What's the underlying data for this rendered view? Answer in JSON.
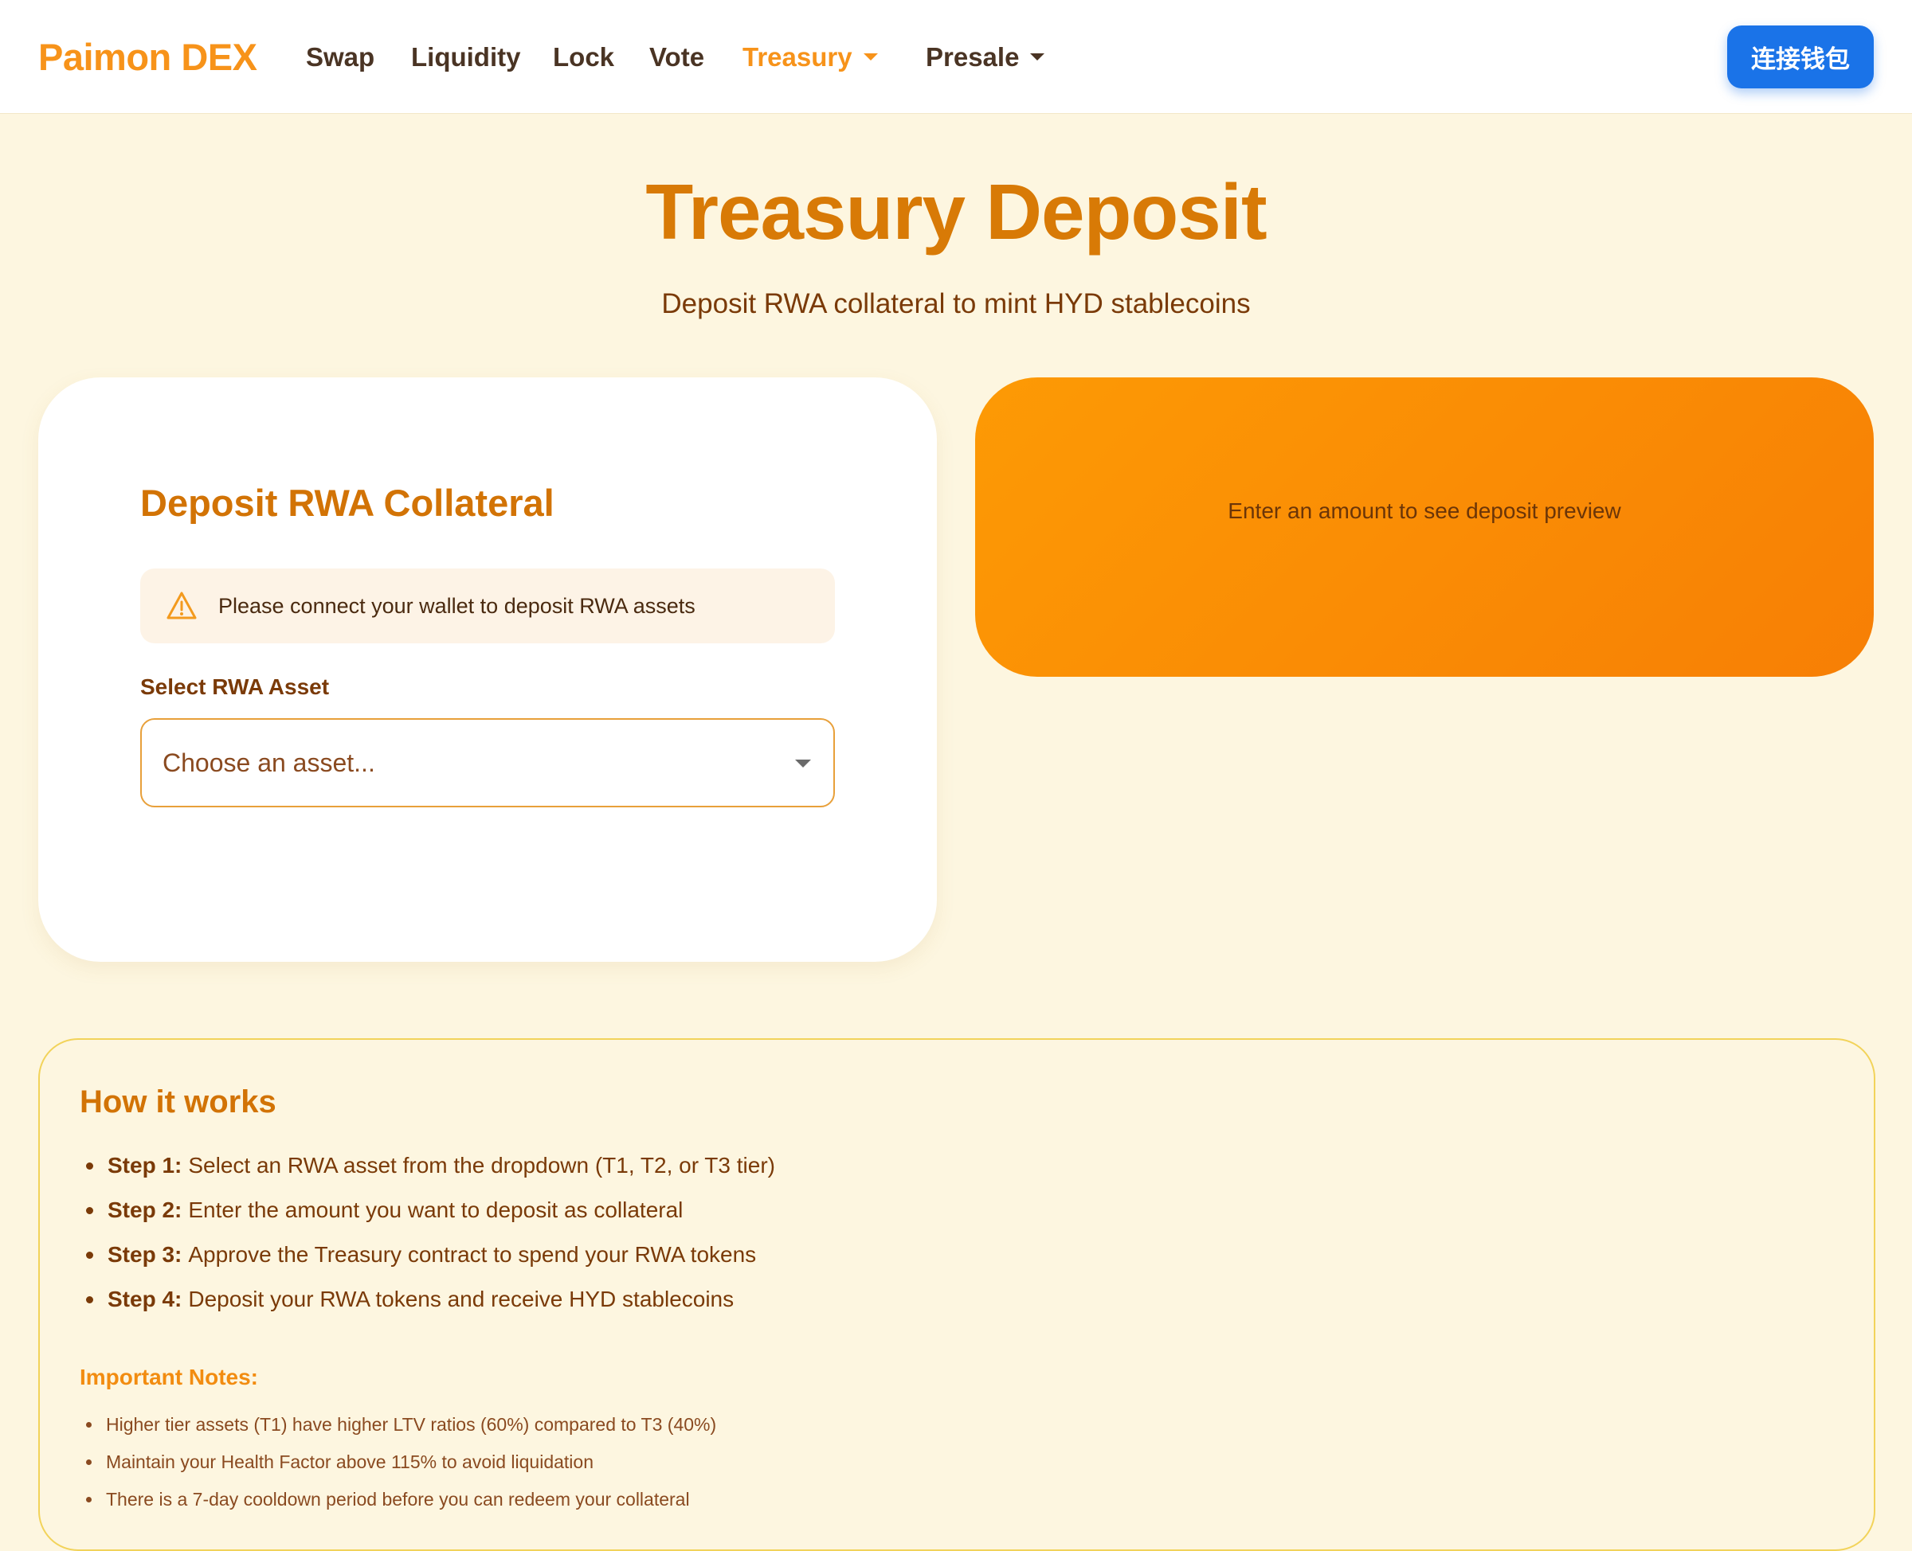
{
  "nav": {
    "logo": "Paimon DEX",
    "items": [
      {
        "label": "Swap"
      },
      {
        "label": "Liquidity"
      },
      {
        "label": "Lock"
      },
      {
        "label": "Vote"
      },
      {
        "label": "Treasury"
      },
      {
        "label": "Presale"
      }
    ],
    "active_item": "Treasury",
    "connect_button": "连接钱包"
  },
  "hero": {
    "title": "Treasury Deposit",
    "subtitle": "Deposit RWA collateral to mint HYD stablecoins"
  },
  "deposit_card": {
    "title": "Deposit RWA Collateral",
    "alert": "Please connect your wallet to deposit RWA assets",
    "asset_label": "Select RWA Asset",
    "asset_select_value": "Choose an asset..."
  },
  "preview_card": {
    "text": "Enter an amount to see deposit preview"
  },
  "how_it_works": {
    "title": "How it works",
    "steps": [
      {
        "label": "Step 1:",
        "text": "Select an RWA asset from the dropdown (T1, T2, or T3 tier)"
      },
      {
        "label": "Step 2:",
        "text": "Enter the amount you want to deposit as collateral"
      },
      {
        "label": "Step 3:",
        "text": "Approve the Treasury contract to spend your RWA tokens"
      },
      {
        "label": "Step 4:",
        "text": "Deposit your RWA tokens and receive HYD stablecoins"
      }
    ],
    "notes_title": "Important Notes:",
    "notes": [
      "Higher tier assets (T1) have higher LTV ratios (60%) compared to T3 (40%)",
      "Maintain your Health Factor above 115% to avoid liquidation",
      "There is a 7-day cooldown period before you can redeem your collateral"
    ]
  },
  "colors": {
    "brand": "#f7931a",
    "title": "#d87a06",
    "connect_button": "#1a73e8",
    "preview_gradient_start": "#fd9a05",
    "preview_gradient_end": "#f77f05",
    "background": "#fdf6e0"
  },
  "icons": {
    "alert": "warning-triangle-icon",
    "dropdown": "chevron-down-icon"
  }
}
